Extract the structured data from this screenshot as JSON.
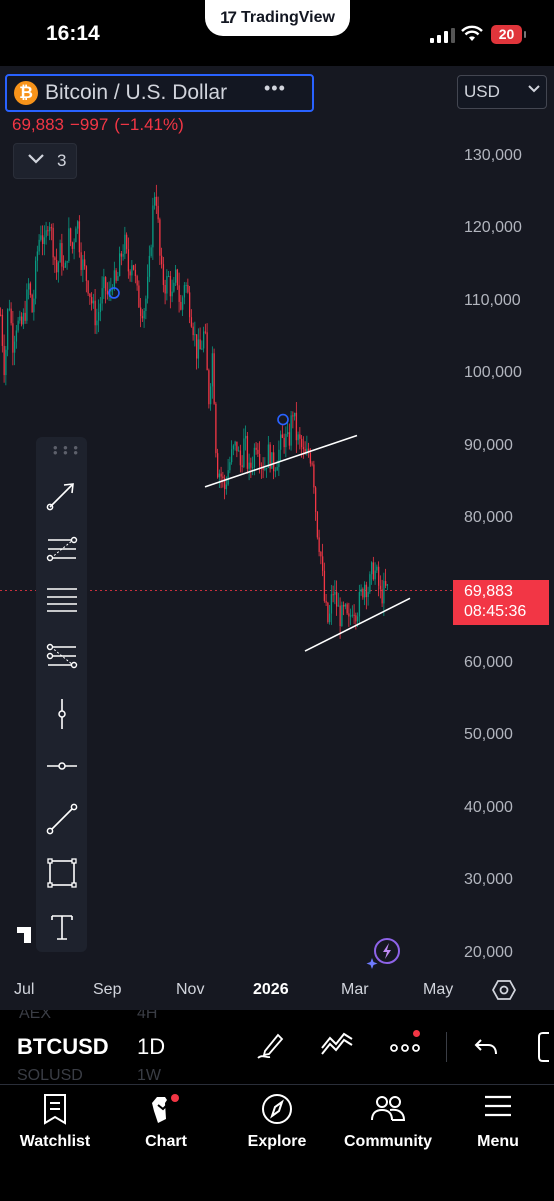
{
  "status_bar": {
    "time": "16:14",
    "app_pill": "TradingView",
    "battery": "20"
  },
  "symbol_header": {
    "name": "Bitcoin / U.S. Dollar",
    "icon_glyph": "₿",
    "more": "•••",
    "currency": "USD",
    "last_price": "69,883",
    "change": "−997",
    "change_pct": "(−1.41%)",
    "indicators_count": "3"
  },
  "price_axis": {
    "labels": [
      "130,000",
      "120,000",
      "110,000",
      "100,000",
      "90,000",
      "80,000",
      "60,000",
      "50,000",
      "40,000",
      "30,000",
      "20,000"
    ],
    "current_price": "69,883",
    "countdown": "08:45:36"
  },
  "time_axis": {
    "labels": [
      "Jul",
      "Sep",
      "Nov",
      "2026",
      "Mar",
      "May"
    ]
  },
  "drawing_toolbar": {
    "tools": [
      "trend-line-arrow",
      "fib-retracement",
      "parallel-channel",
      "fib-extension",
      "vertical-line",
      "horizontal-ray",
      "trend-line",
      "rectangle",
      "text"
    ]
  },
  "symbol_row": {
    "symbol": "BTCUSD",
    "interval": "1D",
    "ghost_above": [
      "AEX",
      "4H"
    ],
    "ghost_below": [
      "SOLUSD",
      "1W"
    ]
  },
  "bottom_nav": [
    {
      "label": "Watchlist",
      "icon": "watchlist-icon"
    },
    {
      "label": "Chart",
      "icon": "chart-icon"
    },
    {
      "label": "Explore",
      "icon": "explore-icon"
    },
    {
      "label": "Community",
      "icon": "community-icon"
    },
    {
      "label": "Menu",
      "icon": "menu-icon"
    }
  ],
  "colors": {
    "up": "#089981",
    "down": "#f23645",
    "accent": "#2962ff",
    "background": "#161821"
  },
  "chart_data": {
    "type": "candlestick",
    "interval": "1D",
    "x_ticks": [
      "Jul",
      "Sep",
      "Nov",
      "2026",
      "Mar",
      "May"
    ],
    "y_ticks": [
      20000,
      30000,
      40000,
      50000,
      60000,
      70000,
      80000,
      90000,
      100000,
      110000,
      120000,
      130000
    ],
    "ylim": [
      20000,
      132000
    ],
    "last_price": 69883,
    "close_path": [
      [
        0,
        108000
      ],
      [
        4,
        100000
      ],
      [
        8,
        111000
      ],
      [
        12,
        104000
      ],
      [
        16,
        107000
      ],
      [
        20,
        106000
      ],
      [
        24,
        108000
      ],
      [
        28,
        112000
      ],
      [
        32,
        108000
      ],
      [
        36,
        116000
      ],
      [
        40,
        120000
      ],
      [
        44,
        117000
      ],
      [
        48,
        122000
      ],
      [
        52,
        118000
      ],
      [
        56,
        114000
      ],
      [
        60,
        117000
      ],
      [
        64,
        113000
      ],
      [
        68,
        119000
      ],
      [
        72,
        117000
      ],
      [
        76,
        122000
      ],
      [
        80,
        116000
      ],
      [
        84,
        114000
      ],
      [
        88,
        112000
      ],
      [
        92,
        109000
      ],
      [
        96,
        107000
      ],
      [
        100,
        110000
      ],
      [
        104,
        112000
      ],
      [
        108,
        110000
      ],
      [
        112,
        113000
      ],
      [
        116,
        112000
      ],
      [
        120,
        116000
      ],
      [
        124,
        118000
      ],
      [
        128,
        114000
      ],
      [
        132,
        116000
      ],
      [
        136,
        111000
      ],
      [
        140,
        109000
      ],
      [
        144,
        109000
      ],
      [
        148,
        113000
      ],
      [
        152,
        122000
      ],
      [
        154,
        125000
      ],
      [
        156,
        124000
      ],
      [
        160,
        114000
      ],
      [
        164,
        112000
      ],
      [
        168,
        113000
      ],
      [
        172,
        110000
      ],
      [
        176,
        114000
      ],
      [
        180,
        108000
      ],
      [
        184,
        113000
      ],
      [
        188,
        110000
      ],
      [
        192,
        107000
      ],
      [
        196,
        103000
      ],
      [
        200,
        103000
      ],
      [
        204,
        106000
      ],
      [
        208,
        96000
      ],
      [
        212,
        103000
      ],
      [
        216,
        87000
      ],
      [
        220,
        86000
      ],
      [
        224,
        84000
      ],
      [
        228,
        87000
      ],
      [
        232,
        89000
      ],
      [
        236,
        90000
      ],
      [
        240,
        87000
      ],
      [
        244,
        91000
      ],
      [
        248,
        86000
      ],
      [
        252,
        88000
      ],
      [
        256,
        91000
      ],
      [
        260,
        88000
      ],
      [
        264,
        87000
      ],
      [
        268,
        89000
      ],
      [
        272,
        87000
      ],
      [
        276,
        88000
      ],
      [
        280,
        90000
      ],
      [
        284,
        91000
      ],
      [
        288,
        90000
      ],
      [
        292,
        95000
      ],
      [
        296,
        91000
      ],
      [
        300,
        90000
      ],
      [
        304,
        88000
      ],
      [
        308,
        89000
      ],
      [
        312,
        88000
      ],
      [
        316,
        79000
      ],
      [
        320,
        75000
      ],
      [
        324,
        68000
      ],
      [
        328,
        65000
      ],
      [
        332,
        70000
      ],
      [
        336,
        68000
      ],
      [
        340,
        66000
      ],
      [
        344,
        67000
      ],
      [
        348,
        65000
      ],
      [
        352,
        68000
      ],
      [
        356,
        67000
      ],
      [
        360,
        69000
      ],
      [
        364,
        71000
      ],
      [
        368,
        70000
      ],
      [
        372,
        73000
      ],
      [
        376,
        72000
      ],
      [
        380,
        69000
      ],
      [
        384,
        70000
      ],
      [
        388,
        69883
      ]
    ],
    "annotations": [
      {
        "type": "trend-line",
        "from": [
          205,
          84200
        ],
        "to": [
          357,
          91300
        ]
      },
      {
        "type": "trend-line",
        "from": [
          305,
          61500
        ],
        "to": [
          410,
          68800
        ]
      },
      {
        "type": "marker-circle",
        "at": [
          114,
          111000
        ]
      },
      {
        "type": "marker-circle",
        "at": [
          283,
          93500
        ]
      }
    ]
  }
}
